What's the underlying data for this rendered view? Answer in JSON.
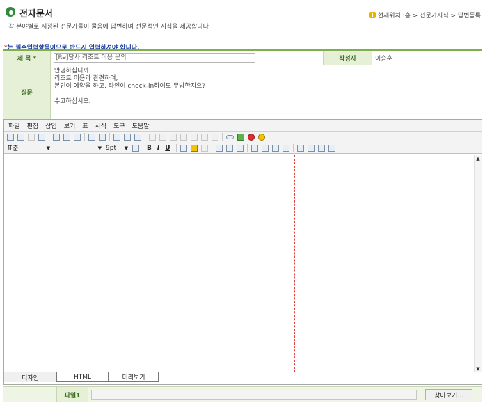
{
  "header": {
    "title": "전자문서",
    "description": "각 분야별로 지정된 전문가들이 물음에 답변하며 전문적인 지식을 제공합니다",
    "location": "현재위치 :홈 > 전문가지식 > 답변등록"
  },
  "notice": {
    "star": "*",
    "text": "는 필수입력항목이므로 반드시 입력하셔야 합니다."
  },
  "form": {
    "subject_label": "제 목 *",
    "subject_value": "[Re]당사 리조트 이용 문의",
    "author_label": "작성자",
    "author_value": "이승훈",
    "question_label": "질문",
    "question_lines": [
      "안녕하십니까.",
      "리조트 이용과 관련하여,",
      "본인이 예약을 하고, 타인이 check-in하여도 무방한지요?",
      "",
      "수고하십시오."
    ]
  },
  "editor": {
    "menu": [
      "파일",
      "편집",
      "삽입",
      "보기",
      "표",
      "서식",
      "도구",
      "도움말"
    ],
    "style_select": "표준",
    "font_select": "",
    "size_select": "9pt",
    "bold": "B",
    "italic": "I",
    "underline": "U",
    "tabs": [
      "디자인",
      "HTML",
      "미리보기"
    ]
  },
  "attachment": {
    "label": "파일1",
    "browse_button": "찾아보기..."
  },
  "colors": {
    "accent_green": "#7fae4c",
    "label_bg": "#e6f0d6",
    "notice_blue": "#1a3c9c",
    "guide_red": "#e04040"
  }
}
